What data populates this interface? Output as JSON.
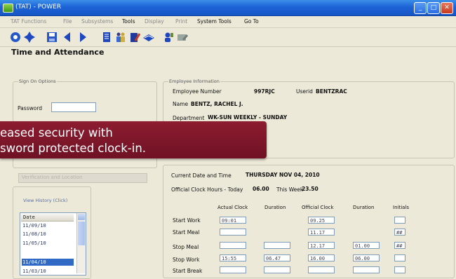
{
  "window": {
    "title": "(TAT) - POWER",
    "buttons": [
      "_",
      "□",
      "✕"
    ]
  },
  "menu": [
    {
      "label": "TAT Functions",
      "enabled": false
    },
    {
      "label": "File",
      "enabled": false
    },
    {
      "label": "Subsystems",
      "enabled": false
    },
    {
      "label": "Tools",
      "enabled": true
    },
    {
      "label": "Display",
      "enabled": false
    },
    {
      "label": "Print",
      "enabled": false
    },
    {
      "label": "System Tools",
      "enabled": true
    },
    {
      "label": "Go To",
      "enabled": true
    }
  ],
  "toolbar": {
    "icons": [
      "globe-icon",
      "navigate-icon",
      "save-icon",
      "previous-icon",
      "next-icon",
      "document-icon",
      "people-icon",
      "notepad-icon",
      "book-icon",
      "person-icon",
      "edit-icon"
    ]
  },
  "app": {
    "title": "Time and Attendance"
  },
  "signon": {
    "group_label": "Sign On Options",
    "password_label": "Password",
    "password_value": "",
    "faded_button": "Verification and Location"
  },
  "history": {
    "link": "View History (Click)",
    "header": "Date",
    "dates": [
      "11/09/10",
      "11/08/10",
      "11/05/10",
      "11/04/10",
      "11/03/10"
    ],
    "selected_index": 3
  },
  "employee": {
    "group_label": "Employee Information",
    "number_label": "Employee Number",
    "number": "997RJC",
    "user_label": "Userid",
    "user": "BENTZRAC",
    "name_label": "Name",
    "name": "BENTZ, RACHEL J.",
    "dept_label": "Department",
    "dept": "WK-SUN WEEKLY - SUNDAY"
  },
  "current": {
    "date_label": "Current Date and Time",
    "date_value": "THURSDAY NOV 04, 2010",
    "today_label": "Official Clock Hours - Today",
    "today_value": "06.00",
    "week_label": "This Week",
    "week_value": "23.50"
  },
  "clock": {
    "headers": [
      "Actual Clock",
      "Duration",
      "Official Clock",
      "Duration",
      "Initials"
    ],
    "rows": [
      {
        "label": "Start Work",
        "actual": "09:01",
        "duration": "",
        "official": "09.25",
        "official_duration": "",
        "initials": ""
      },
      {
        "label": "Start Meal",
        "actual": "",
        "duration": "",
        "official": "11.17",
        "official_duration": "",
        "initials": "##"
      },
      {
        "label": "Stop Meal",
        "actual": "",
        "duration": "",
        "official": "12.17",
        "official_duration": "01.00",
        "initials": "##"
      },
      {
        "label": "Stop Work",
        "actual": "15:55",
        "duration": "06.47",
        "official": "16.00",
        "official_duration": "06.00",
        "initials": ""
      },
      {
        "label": "Start Break",
        "actual": "",
        "duration": "",
        "official": "",
        "official_duration": "",
        "initials": ""
      }
    ]
  },
  "banner": {
    "line1": "eased security with",
    "line2": "sword protected clock-in."
  }
}
